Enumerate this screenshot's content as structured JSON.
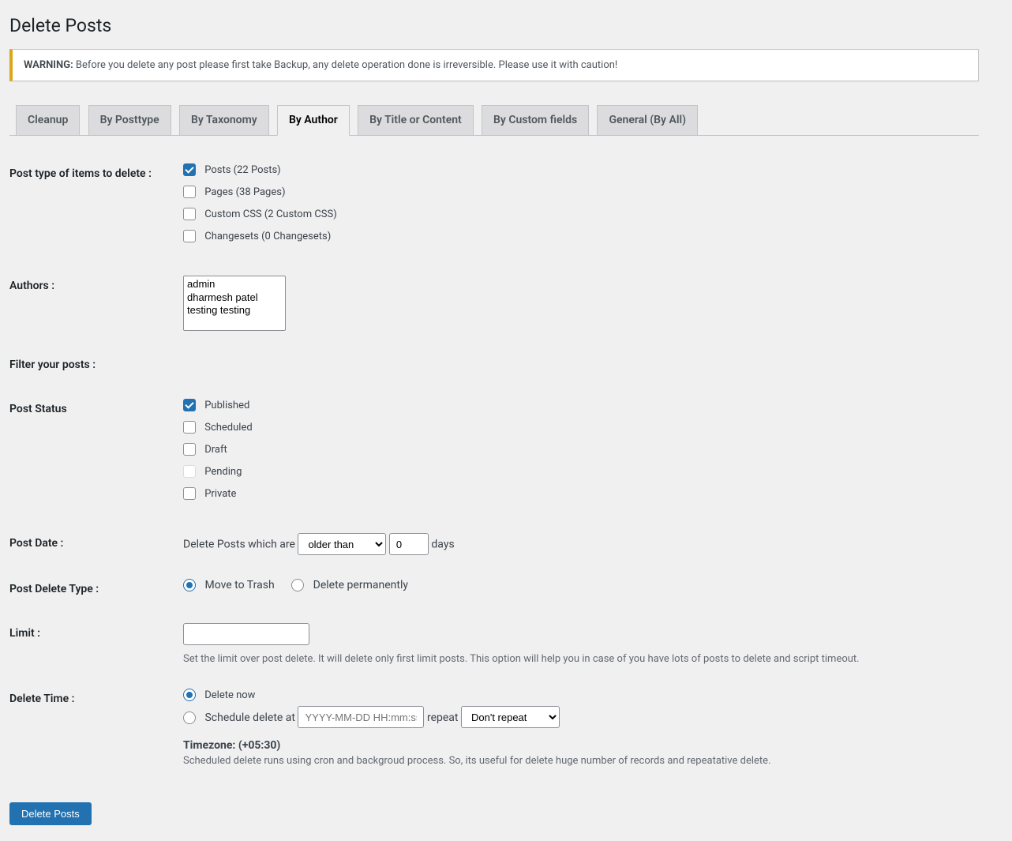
{
  "header": {
    "title": "Delete Posts",
    "warning_strong": "WARNING:",
    "warning_text": " Before you delete any post please first take Backup, any delete operation done is irreversible. Please use it with caution!"
  },
  "tabs": [
    "Cleanup",
    "By Posttype",
    "By Taxonomy",
    "By Author",
    "By Title or Content",
    "By Custom fields",
    "General (By All)"
  ],
  "active_tab_index": 3,
  "labels": {
    "post_type": "Post type of items to delete :",
    "authors": "Authors :",
    "filter": "Filter your posts :",
    "post_status": "Post Status",
    "post_date": "Post Date :",
    "delete_type": "Post Delete Type :",
    "limit": "Limit :",
    "delete_time": "Delete Time :"
  },
  "post_types": [
    {
      "label": "Posts (22 Posts)",
      "checked": true
    },
    {
      "label": "Pages (38 Pages)",
      "checked": false
    },
    {
      "label": "Custom CSS (2 Custom CSS)",
      "checked": false
    },
    {
      "label": "Changesets (0 Changesets)",
      "checked": false
    }
  ],
  "authors": [
    "admin",
    "dharmesh patel",
    "testing testing"
  ],
  "status": [
    {
      "label": "Published",
      "checked": true
    },
    {
      "label": "Scheduled",
      "checked": false
    },
    {
      "label": "Draft",
      "checked": false
    },
    {
      "label": "Pending",
      "checked": false
    },
    {
      "label": "Private",
      "checked": false
    }
  ],
  "date": {
    "intro": "Delete Posts which are",
    "select": "older than",
    "value": "0",
    "unit": "days"
  },
  "delete_type": {
    "trash": "Move to Trash",
    "perm": "Delete permanently",
    "selected": "trash"
  },
  "limit_desc": "Set the limit over post delete. It will delete only first limit posts. This option will help you in case of you have lots of posts to delete and script timeout.",
  "time": {
    "now": "Delete now",
    "schedule": "Schedule delete at",
    "placeholder": "YYYY-MM-DD HH:mm:ss",
    "repeat_label": "repeat",
    "repeat_select": "Don't repeat",
    "tz_label": "Timezone:",
    "tz_value": " (+05:30)",
    "desc": "Scheduled delete runs using cron and backgroud process. So, its useful for delete huge number of records and repeatative delete."
  },
  "submit": "Delete Posts"
}
